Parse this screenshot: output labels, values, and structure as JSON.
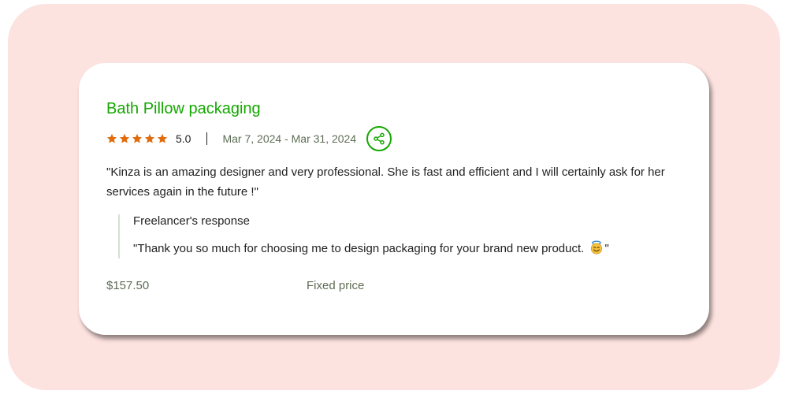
{
  "colors": {
    "backdrop": "#fde3e0",
    "accent_green": "#14a800",
    "star_orange": "#e06c0e",
    "text_dark": "#222222",
    "text_muted": "#5e6d55"
  },
  "review": {
    "title": "Bath Pillow packaging",
    "stars_filled": 5,
    "stars_total": 5,
    "rating": "5.0",
    "date_range": "Mar 7, 2024 - Mar 31, 2024",
    "share_icon": "share-icon",
    "feedback": "\"Kinza is an amazing designer and very professional. She is fast and efficient and I will certainly ask for her services again in the future !\"",
    "response": {
      "label": "Freelancer's response",
      "text": "\"Thank you so much for choosing me to design packaging for your brand new product.",
      "text_end": "\"",
      "emoji_icon": "smiling-face-with-halo-emoji"
    },
    "price": "$157.50",
    "price_type": "Fixed price"
  }
}
